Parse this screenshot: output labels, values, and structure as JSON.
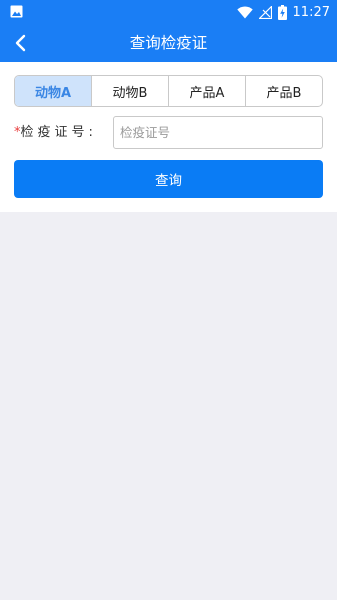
{
  "status_bar": {
    "time": "11:27",
    "icons": [
      "image-icon",
      "wifi-icon",
      "signal-icon",
      "battery-charging-icon"
    ]
  },
  "app_bar": {
    "title": "查询检疫证",
    "back_icon": "chevron-left-icon"
  },
  "tabs": [
    {
      "label": "动物A",
      "active": true
    },
    {
      "label": "动物B",
      "active": false
    },
    {
      "label": "产品A",
      "active": false
    },
    {
      "label": "产品B",
      "active": false
    }
  ],
  "form": {
    "required_mark": "*",
    "cert_label": "检疫证号:",
    "cert_placeholder": "检疫证号",
    "cert_value": ""
  },
  "query_button": {
    "label": "查询"
  },
  "colors": {
    "primary": "#1a7ef5",
    "button": "#0a7cf5",
    "tab_active_bg": "#cfe3fb",
    "tab_active_text": "#3a86e4",
    "required": "#e83a3a",
    "page_bg": "#efeff4"
  }
}
